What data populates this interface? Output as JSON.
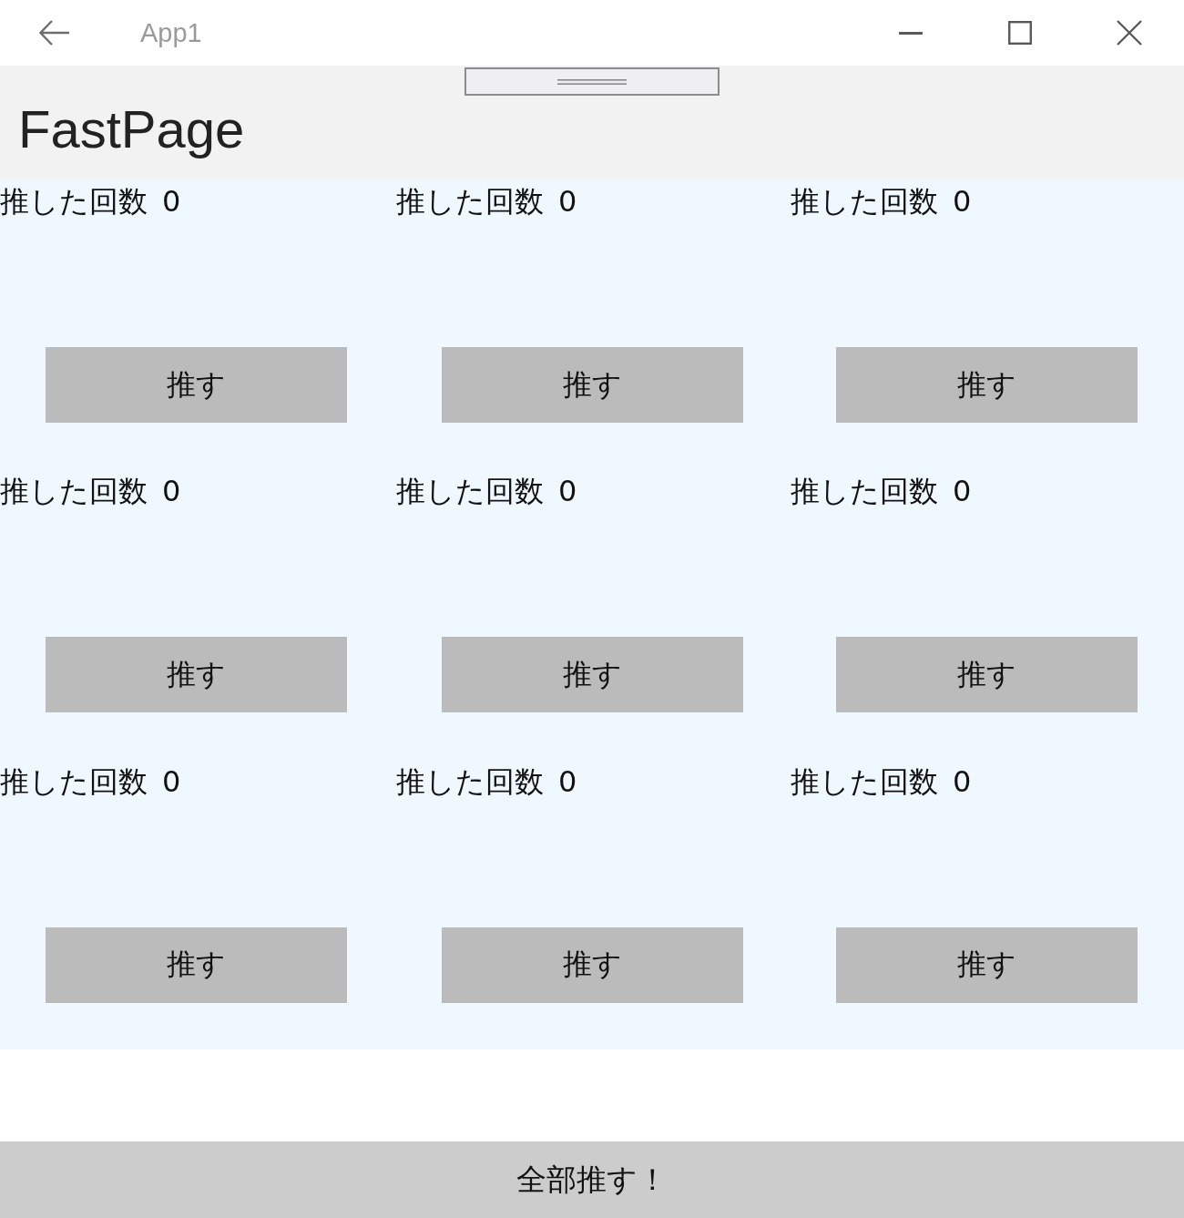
{
  "window": {
    "title": "App1"
  },
  "header": {
    "title": "FastPage"
  },
  "counters": [
    {
      "label": "推した回数",
      "count": "0",
      "button": "推す"
    },
    {
      "label": "推した回数",
      "count": "0",
      "button": "推す"
    },
    {
      "label": "推した回数",
      "count": "0",
      "button": "推す"
    },
    {
      "label": "推した回数",
      "count": "0",
      "button": "推す"
    },
    {
      "label": "推した回数",
      "count": "0",
      "button": "推す"
    },
    {
      "label": "推した回数",
      "count": "0",
      "button": "推す"
    },
    {
      "label": "推した回数",
      "count": "0",
      "button": "推す"
    },
    {
      "label": "推した回数",
      "count": "0",
      "button": "推す"
    },
    {
      "label": "推した回数",
      "count": "0",
      "button": "推す"
    }
  ],
  "footer_button": "全部推す！"
}
